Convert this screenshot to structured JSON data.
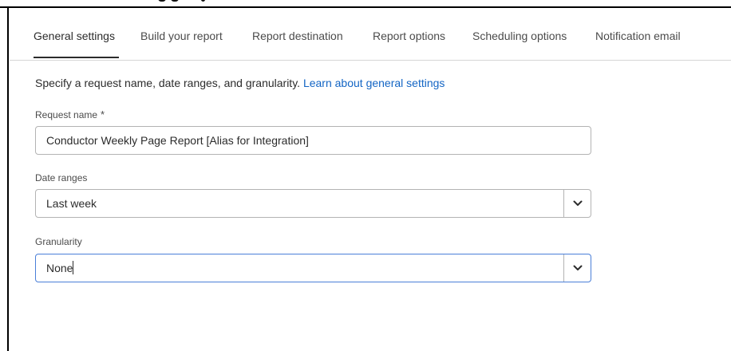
{
  "tabs": [
    {
      "label": "General settings",
      "active": true
    },
    {
      "label": "Build your report",
      "active": false
    },
    {
      "label": "Report destination",
      "active": false
    },
    {
      "label": "Report options",
      "active": false
    },
    {
      "label": "Scheduling options",
      "active": false
    },
    {
      "label": "Notification email",
      "active": false
    }
  ],
  "intro": {
    "text": "Specify a request name, date ranges, and granularity. ",
    "link": "Learn about general settings"
  },
  "request_name": {
    "label": "Request name",
    "required_marker": "*",
    "value": "Conductor Weekly Page Report [Alias for Integration]"
  },
  "date_ranges": {
    "label": "Date ranges",
    "value": "Last week",
    "icon": "chevron-down-icon"
  },
  "granularity": {
    "label": "Granularity",
    "value": "None",
    "icon": "chevron-down-icon",
    "focused": true
  },
  "colors": {
    "link": "#1365c4",
    "focus_border": "#4a7fd8",
    "text": "#2c2c2c"
  }
}
